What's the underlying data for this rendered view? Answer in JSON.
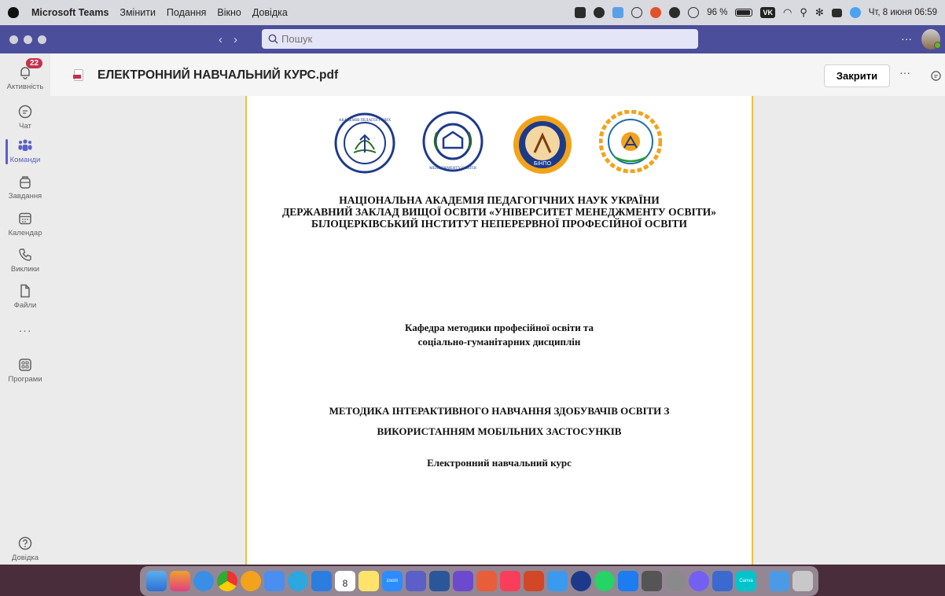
{
  "menubar": {
    "app_name": "Microsoft Teams",
    "menus": [
      "Змінити",
      "Подання",
      "Вікно",
      "Довідка"
    ],
    "battery": "96 %",
    "clock": "Чт, 8 июня 06:59",
    "vk": "VK"
  },
  "titlebar": {
    "back": "‹",
    "forward": "›",
    "search_placeholder": "Пошук",
    "more": "···"
  },
  "rail": {
    "activity": {
      "label": "Активність",
      "badge": "22"
    },
    "chat": "Чат",
    "teams": "Команди",
    "assignments": "Завдання",
    "calendar": "Календар",
    "calls": "Виклики",
    "files": "Файли",
    "more": "···",
    "apps": "Програми",
    "help": "Довідка"
  },
  "document": {
    "title": "ЕЛЕКТРОННИЙ НАВЧАЛЬНИЙ КУРС.pdf",
    "close_label": "Закрити",
    "more": "···"
  },
  "page": {
    "institution_lines": [
      "НАЦІОНАЛЬНА АКАДЕМІЯ ПЕДАГОГІЧНИХ НАУК УКРАЇНИ",
      "ДЕРЖАВНИЙ ЗАКЛАД ВИЩОЇ ОСВІТИ «УНІВЕРСИТЕТ МЕНЕДЖМЕНТУ ОСВІТИ»",
      "БІЛОЦЕРКІВСЬКИЙ  ІНСТИТУТ  НЕПЕРЕРВНОЇ  ПРОФЕСІЙНОЇ  ОСВІТИ"
    ],
    "department_lines": [
      "Кафедра методики професійної освіти та",
      "соціально-гуманітарних дисциплін"
    ],
    "course_title_lines": [
      "МЕТОДИКА ІНТЕРАКТИВНОГО НАВЧАННЯ ЗДОБУВАЧІВ ОСВІТИ З",
      "ВИКОРИСТАННЯМ МОБІЛЬНИХ ЗАСТОСУНКІВ"
    ],
    "subtitle": "Електронний навчальний курс",
    "logos": [
      "napn-logo",
      "ume-logo",
      "binpo-logo",
      "department-logo"
    ],
    "logo_texts": {
      "binpo": "БІНПО"
    }
  },
  "dock": {
    "calendar_day": "8",
    "zoom": "zoom",
    "canva": "Canva",
    "month": "ЧЕРВ."
  },
  "colors": {
    "teams_purple": "#4b4e9a",
    "accent": "#5b5fc7",
    "page_border": "#f0c03c",
    "badge": "#c4314b"
  }
}
